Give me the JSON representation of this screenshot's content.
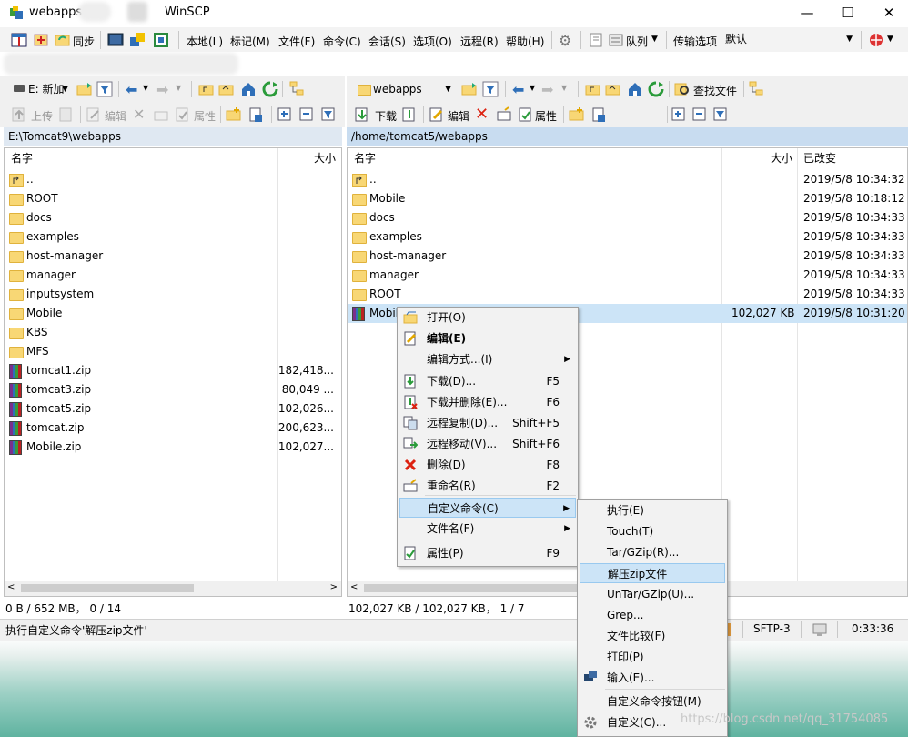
{
  "titlebar": {
    "doc": "webapps",
    "app": "WinSCP",
    "minimize": "—",
    "maximize": "☐",
    "close": "✕"
  },
  "toolbar": {
    "sync_label": "同步",
    "queue_label": "队列",
    "transfer_options_label": "传输选项",
    "transfer_preset": "默认",
    "menus": [
      "本地(L)",
      "标记(M)",
      "文件(F)",
      "命令(C)",
      "会话(S)",
      "选项(O)",
      "远程(R)",
      "帮助(H)"
    ]
  },
  "local": {
    "drive": "E: 新加",
    "upload_label": "上传",
    "edit_label": "编辑",
    "props_label": "属性",
    "path": "E:\\Tomcat9\\webapps",
    "col_name": "名字",
    "col_size": "大小",
    "files": [
      {
        "name": "..",
        "size": "",
        "type": "up"
      },
      {
        "name": "ROOT",
        "size": "",
        "type": "folder"
      },
      {
        "name": "docs",
        "size": "",
        "type": "folder"
      },
      {
        "name": "examples",
        "size": "",
        "type": "folder"
      },
      {
        "name": "host-manager",
        "size": "",
        "type": "folder"
      },
      {
        "name": "manager",
        "size": "",
        "type": "folder"
      },
      {
        "name": "inputsystem",
        "size": "",
        "type": "folder"
      },
      {
        "name": "Mobile",
        "size": "",
        "type": "folder"
      },
      {
        "name": "KBS",
        "size": "",
        "type": "folder"
      },
      {
        "name": "MFS",
        "size": "",
        "type": "folder"
      },
      {
        "name": "tomcat1.zip",
        "size": "182,418...",
        "type": "zip"
      },
      {
        "name": "tomcat3.zip",
        "size": "80,049 ...",
        "type": "zip"
      },
      {
        "name": "tomcat5.zip",
        "size": "102,026...",
        "type": "zip"
      },
      {
        "name": "tomcat.zip",
        "size": "200,623...",
        "type": "zip"
      },
      {
        "name": "Mobile.zip",
        "size": "102,027...",
        "type": "zip"
      }
    ],
    "status": "0 B / 652 MB， 0 / 14"
  },
  "remote": {
    "dir": "webapps",
    "download_label": "下载",
    "edit_label": "编辑",
    "props_label": "属性",
    "find_label": "查找文件",
    "path": "/home/tomcat5/webapps",
    "col_name": "名字",
    "col_size": "大小",
    "col_changed": "已改变",
    "files": [
      {
        "name": "..",
        "size": "",
        "changed": "2019/5/8 10:34:32",
        "type": "up"
      },
      {
        "name": "Mobile",
        "size": "",
        "changed": "2019/5/8 10:18:12",
        "type": "folder"
      },
      {
        "name": "docs",
        "size": "",
        "changed": "2019/5/8 10:34:33",
        "type": "folder"
      },
      {
        "name": "examples",
        "size": "",
        "changed": "2019/5/8 10:34:33",
        "type": "folder"
      },
      {
        "name": "host-manager",
        "size": "",
        "changed": "2019/5/8 10:34:33",
        "type": "folder"
      },
      {
        "name": "manager",
        "size": "",
        "changed": "2019/5/8 10:34:33",
        "type": "folder"
      },
      {
        "name": "ROOT",
        "size": "",
        "changed": "2019/5/8 10:34:33",
        "type": "folder"
      },
      {
        "name": "Mobile.zip",
        "size": "102,027 KB",
        "changed": "2019/5/8 10:31:20",
        "type": "zip",
        "selected": true
      }
    ],
    "status": "102,027 KB / 102,027 KB， 1 / 7"
  },
  "status_bar": {
    "message": "执行自定义命令'解压zip文件'",
    "protocol": "SFTP-3",
    "time": "0:33:36"
  },
  "context_menu": {
    "items": [
      {
        "label": "打开(O)",
        "shortcut": "",
        "icon": "open-icon"
      },
      {
        "label": "编辑(E)",
        "shortcut": "",
        "icon": "edit-icon",
        "bold": true
      },
      {
        "label": "编辑方式...(I)",
        "shortcut": "",
        "icon": "",
        "submenu": true
      },
      {
        "label": "下载(D)...",
        "shortcut": "F5",
        "icon": "download-icon"
      },
      {
        "label": "下载并删除(E)...",
        "shortcut": "F6",
        "icon": "download-delete-icon"
      },
      {
        "label": "远程复制(D)...",
        "shortcut": "Shift+F5",
        "icon": "remote-copy-icon"
      },
      {
        "label": "远程移动(V)...",
        "shortcut": "Shift+F6",
        "icon": "remote-move-icon"
      },
      {
        "label": "删除(D)",
        "shortcut": "F8",
        "icon": "delete-icon"
      },
      {
        "label": "重命名(R)",
        "shortcut": "F2",
        "icon": "rename-icon"
      },
      {
        "label": "自定义命令(C)",
        "shortcut": "",
        "icon": "",
        "submenu": true,
        "highlighted": true
      },
      {
        "label": "文件名(F)",
        "shortcut": "",
        "icon": "",
        "submenu": true
      },
      {
        "label": "属性(P)",
        "shortcut": "F9",
        "icon": "properties-icon"
      }
    ]
  },
  "custom_menu": {
    "items": [
      {
        "label": "执行(E)"
      },
      {
        "label": "Touch(T)"
      },
      {
        "label": "Tar/GZip(R)..."
      },
      {
        "label": "解压zip文件",
        "highlighted": true
      },
      {
        "label": "UnTar/GZip(U)..."
      },
      {
        "label": "Grep..."
      },
      {
        "label": "文件比较(F)"
      },
      {
        "label": "打印(P)"
      },
      {
        "label": "输入(E)...",
        "icon": "input-icon"
      },
      {
        "label": "自定义命令按钮(M)"
      },
      {
        "label": "自定义(C)...",
        "icon": "gear-icon"
      }
    ]
  },
  "watermark": "https://blog.csdn.net/qq_31754085"
}
